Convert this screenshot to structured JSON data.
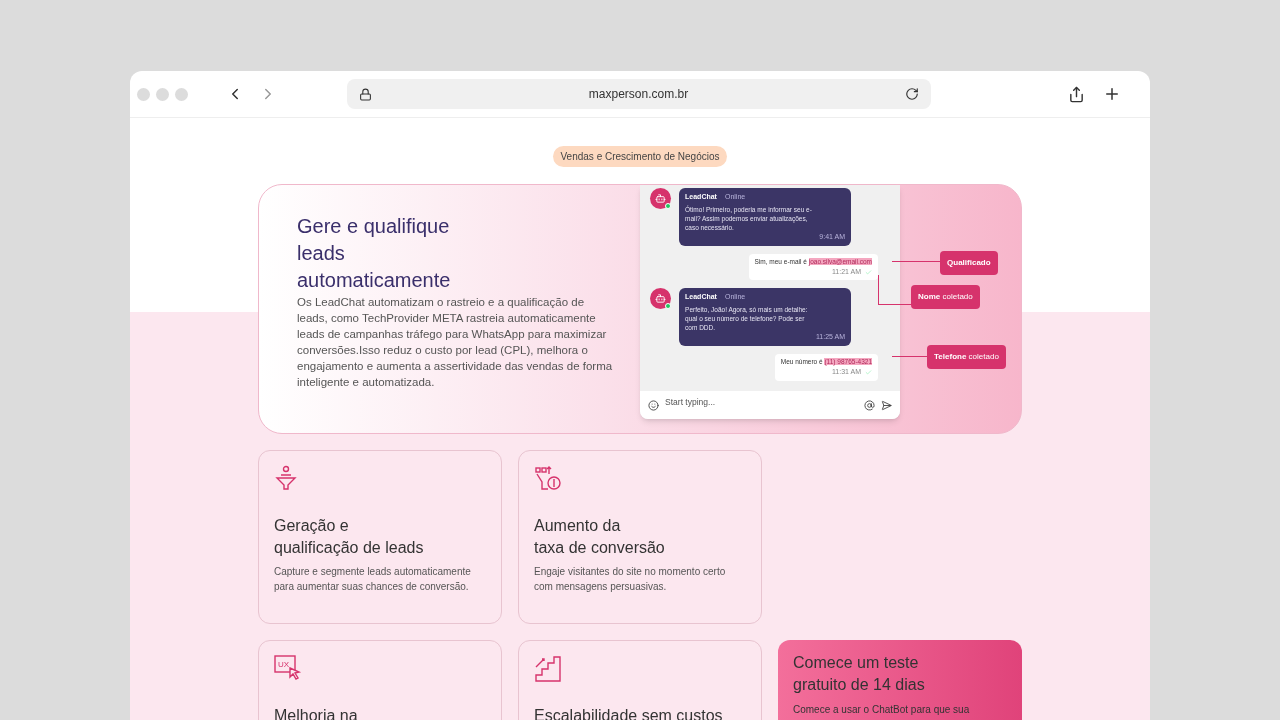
{
  "browser": {
    "url": "maxperson.com.br"
  },
  "badge": "Vendas e Crescimento de Negócios",
  "hero": {
    "title": "Gere e qualifique leads automaticamente",
    "body": "Os LeadChat automatizam o rastreio e a qualificação de leads, como TechProvider META rastreia automaticamente leads de campanhas tráfego para WhatsApp para maximizar conversões.Isso reduz o custo por lead (CPL), melhora o engajamento e aumenta a assertividade das vendas de forma inteligente e automatizada."
  },
  "chat": {
    "messages": [
      {
        "kind": "bot",
        "sender": "LeadChat",
        "status": "Online",
        "text": "Ótimo! Primeiro, poderia me informar seu e-mail? Assim podemos enviar atualizações, caso necessário.",
        "time": "9:41 AM"
      },
      {
        "kind": "user",
        "text": "Sim, meu e-mail é",
        "highlight": "joao.silva@email.com",
        "time": "11:21 AM"
      },
      {
        "kind": "bot",
        "sender": "LeadChat",
        "status": "Online",
        "text": "Perfeito, João! Agora, só mais um detalhe: qual o seu número de telefone? Pode ser com DDD.",
        "time": "11:25 AM"
      },
      {
        "kind": "user",
        "text": "Meu número é",
        "highlight": "(11) 98765-4321",
        "time": "11:31 AM"
      }
    ],
    "placeholder": "Start typing...",
    "tags": [
      {
        "bold": "Qualificado"
      },
      {
        "bold": "Nome",
        "rest": "coletado"
      },
      {
        "bold": "Telefone",
        "rest": "coletado"
      }
    ]
  },
  "features": [
    {
      "kind": "funnel",
      "title": "Geração e\nqualificação de leads",
      "text": "Capture e segmente leads automaticamente para aumentar suas chances de conversão."
    },
    {
      "kind": "conversion",
      "title": "Aumento da\ntaxa de conversão",
      "text": "Engaje visitantes do site no momento certo com mensagens persuasivas."
    },
    {
      "kind": "ux",
      "icon_label": "UX",
      "title": "Melhoria na"
    },
    {
      "kind": "stairs",
      "title": "Escalabilidade sem custos"
    }
  ],
  "cta": {
    "title": "Comece um teste gratuito de 14 dias",
    "text": "Comece a usar o ChatBot para que sua"
  }
}
